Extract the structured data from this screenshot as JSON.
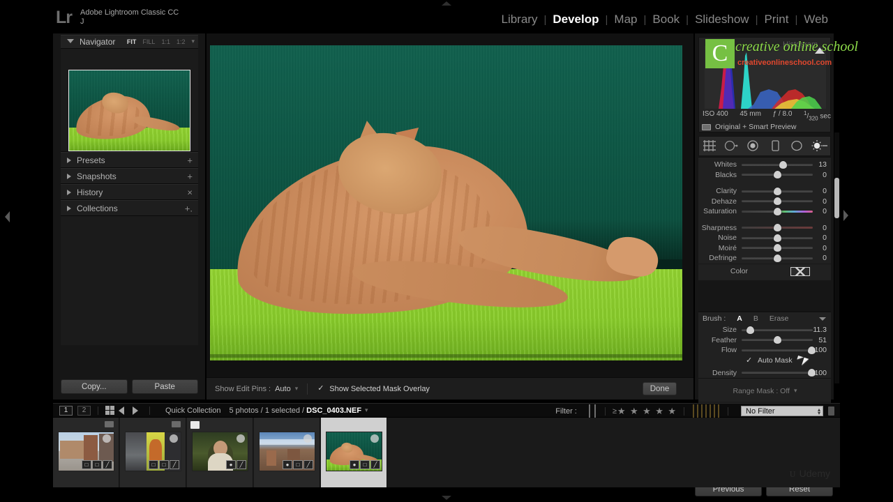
{
  "app": {
    "logo": "Lr",
    "title_line1": "Adobe Lightroom Classic CC",
    "title_line2": "J"
  },
  "modules": [
    {
      "label": "Library",
      "active": false
    },
    {
      "label": "Develop",
      "active": true
    },
    {
      "label": "Map",
      "active": false
    },
    {
      "label": "Book",
      "active": false
    },
    {
      "label": "Slideshow",
      "active": false
    },
    {
      "label": "Print",
      "active": false
    },
    {
      "label": "Web",
      "active": false
    }
  ],
  "left_panel": {
    "navigator": {
      "title": "Navigator",
      "zoom_levels": [
        "FIT",
        "FILL",
        "1:1",
        "1:2"
      ],
      "selected_zoom": "FIT"
    },
    "sections": [
      {
        "title": "Presets",
        "action": "+"
      },
      {
        "title": "Snapshots",
        "action": "+"
      },
      {
        "title": "History",
        "action": "×"
      },
      {
        "title": "Collections",
        "action": "+."
      }
    ],
    "buttons": {
      "copy": "Copy...",
      "paste": "Paste"
    }
  },
  "image_toolbar": {
    "edit_pins_label": "Show Edit Pins :",
    "edit_pins_value": "Auto",
    "mask_overlay_label": "Show Selected Mask Overlay",
    "mask_overlay_checked": true,
    "done_label": "Done"
  },
  "right_panel": {
    "watermark": {
      "logo_letter": "C",
      "script_text": "creative online school",
      "sub_text": "creativeonlineschool.com",
      "ghost_text": "Histogram"
    },
    "exif": {
      "iso": "ISO 400",
      "focal": "45 mm",
      "aperture": "ƒ / 8.0",
      "shutter_num": "1",
      "shutter_den": "320",
      "shutter_unit": "sec"
    },
    "preview_status": "Original + Smart Preview",
    "tools": [
      {
        "name": "crop-overlay",
        "active": false
      },
      {
        "name": "spot-removal",
        "active": false
      },
      {
        "name": "red-eye-correction",
        "active": false
      },
      {
        "name": "graduated-filter",
        "active": false
      },
      {
        "name": "radial-filter",
        "active": false
      },
      {
        "name": "adjustment-brush",
        "active": true
      }
    ],
    "sliders_group_1": [
      {
        "name": "Whites",
        "value": "13",
        "pos": 58
      },
      {
        "name": "Blacks",
        "value": "0",
        "pos": 50
      }
    ],
    "sliders_group_2": [
      {
        "name": "Clarity",
        "value": "0",
        "pos": 50
      },
      {
        "name": "Dehaze",
        "value": "0",
        "pos": 50
      },
      {
        "name": "Saturation",
        "value": "0",
        "pos": 50,
        "tint": "saturation"
      }
    ],
    "sliders_group_3": [
      {
        "name": "Sharpness",
        "value": "0",
        "pos": 50,
        "tint": "red"
      },
      {
        "name": "Noise",
        "value": "0",
        "pos": 50
      },
      {
        "name": "Moiré",
        "value": "0",
        "pos": 50
      },
      {
        "name": "Defringe",
        "value": "0",
        "pos": 50
      }
    ],
    "color_row_label": "Color",
    "brush": {
      "label": "Brush :",
      "options": [
        "A",
        "B",
        "Erase"
      ],
      "selected": "A",
      "sliders": [
        {
          "name": "Size",
          "value": "11.3",
          "pos": 12
        },
        {
          "name": "Feather",
          "value": "51",
          "pos": 50
        },
        {
          "name": "Flow",
          "value": "100",
          "pos": 100
        }
      ],
      "auto_mask_label": "Auto Mask",
      "auto_mask_checked": true,
      "density": {
        "name": "Density",
        "value": "100",
        "pos": 100
      }
    },
    "range_mask": "Range Mask : Off",
    "buttons": {
      "previous": "Previous",
      "reset": "Reset"
    }
  },
  "filmstrip_bar": {
    "page_1": "1",
    "page_2": "2",
    "quick_collection": "Quick Collection",
    "photo_info_prefix": "5 photos / 1 selected / ",
    "photo_filename": "DSC_0403.NEF",
    "filter_label": "Filter :",
    "star_prefix": "≥",
    "stars": 5,
    "no_filter": "No Filter",
    "color_labels": [
      "#c0392b",
      "#7fb800",
      "#3b7d3b",
      "#2b4f9e",
      "#6a3fa0",
      "#8d8d8d",
      "#5a5a5a"
    ]
  },
  "filmstrip": {
    "thumbs": [
      {
        "name": "piazza-buildings",
        "selected": false,
        "top_badge": "dim",
        "icons": [
          "crop",
          "flag",
          "develop"
        ]
      },
      {
        "name": "street-shops",
        "selected": false,
        "top_badge": "dim",
        "icons": [
          "crop",
          "flag",
          "develop"
        ]
      },
      {
        "name": "portrait-man",
        "selected": false,
        "top_badge": "light",
        "icons": [
          "brush",
          "develop"
        ]
      },
      {
        "name": "cityscape-hills",
        "selected": false,
        "top_badge": "none",
        "icons": [
          "brush",
          "crop",
          "develop"
        ]
      },
      {
        "name": "cat-green-wall",
        "selected": true,
        "top_badge": "none",
        "icons": [
          "brush",
          "crop",
          "develop"
        ]
      }
    ]
  },
  "watermark_bottom": {
    "text": "Udemy",
    "glyph": "ᴜ"
  }
}
